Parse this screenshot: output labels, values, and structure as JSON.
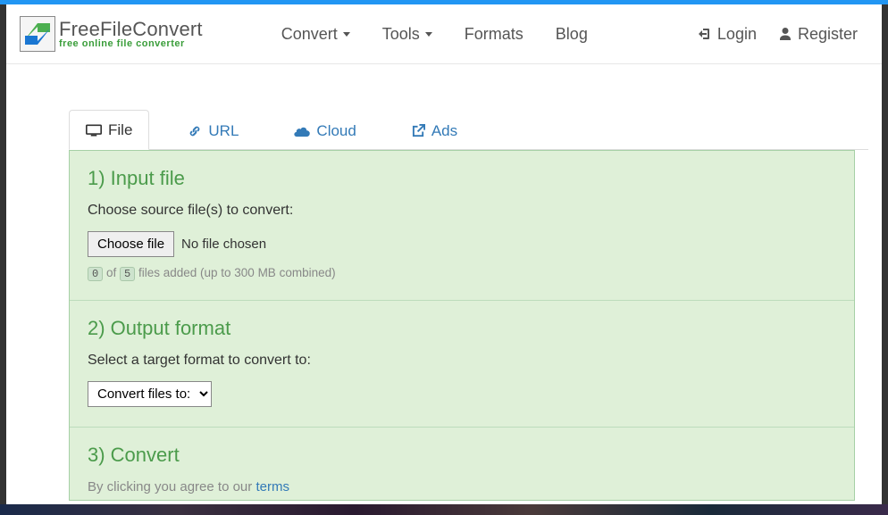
{
  "logo": {
    "top": "FreeFileConvert",
    "bottom": "free online file converter"
  },
  "nav": {
    "convert": "Convert",
    "tools": "Tools",
    "formats": "Formats",
    "blog": "Blog",
    "login": "Login",
    "register": "Register"
  },
  "tabs": {
    "file": "File",
    "url": "URL",
    "cloud": "Cloud",
    "ads": "Ads"
  },
  "step1": {
    "title": "1) Input file",
    "instruction": "Choose source file(s) to convert:",
    "choose_btn": "Choose file",
    "file_status": "No file chosen",
    "count_current": "0",
    "count_of": "of",
    "count_max": "5",
    "count_suffix": "files added (up to 300 MB combined)"
  },
  "step2": {
    "title": "2) Output format",
    "instruction": "Select a target format to convert to:",
    "select_default": "Convert files to:"
  },
  "step3": {
    "title": "3) Convert",
    "terms_prefix": "By clicking you agree to our ",
    "terms_link": "terms"
  }
}
